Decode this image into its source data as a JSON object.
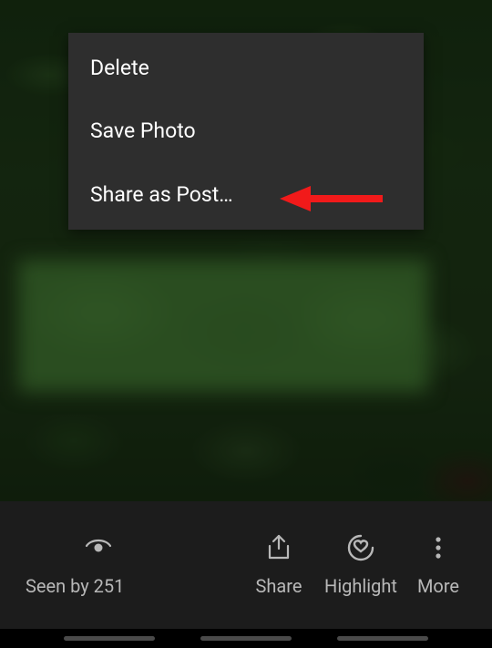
{
  "menu": {
    "items": [
      {
        "label": "Delete"
      },
      {
        "label": "Save Photo"
      },
      {
        "label": "Share as Post…"
      }
    ]
  },
  "bottom_bar": {
    "seen_label": "Seen by 251",
    "share_label": "Share",
    "highlight_label": "Highlight",
    "more_label": "More"
  },
  "annotation": {
    "arrow_color": "#f11a1a"
  }
}
